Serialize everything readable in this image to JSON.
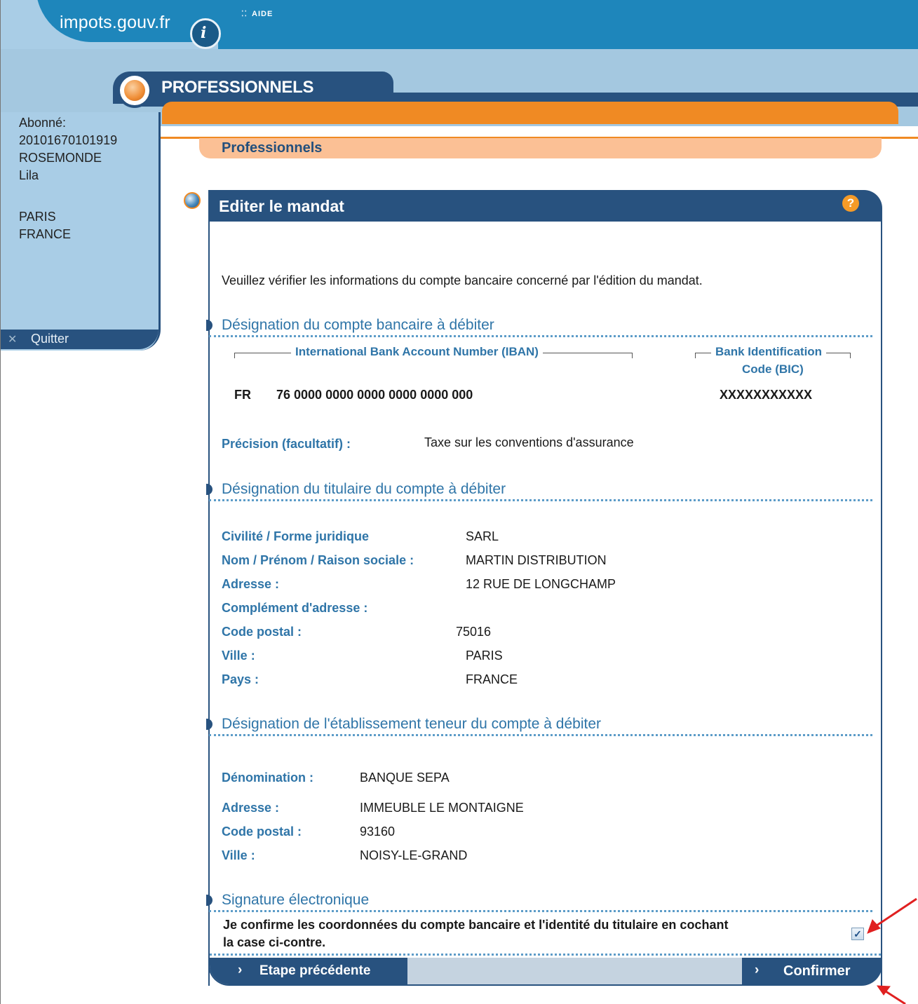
{
  "header": {
    "site_title": "impots.gouv.fr",
    "info_glyph": "i",
    "aide_label": "AIDE",
    "section_label": "PROFESSIONNELS"
  },
  "sidebar": {
    "subscriber_label": "Abonné:",
    "subscriber_id": "20101670101919",
    "last_name": "ROSEMONDE",
    "first_name": "Lila",
    "city": "PARIS",
    "country": "FRANCE",
    "quit_label": "Quitter"
  },
  "breadcrumb": "Professionnels",
  "panel": {
    "title": "Editer le mandat",
    "help_glyph": "?",
    "intro": "Veuillez vérifier les informations du compte bancaire concerné par l'édition du mandat."
  },
  "bank_account": {
    "section_title": "Désignation du compte bancaire à débiter",
    "iban_header": "International Bank Account Number  (IBAN)",
    "bic_header_line1": "Bank Identification",
    "bic_header_line2": "Code (BIC)",
    "country_code": "FR",
    "iban_value": "76  0000 0000 0000 0000 0000 000",
    "bic_value": "XXXXXXXXXXX",
    "precision_label": "Précision (facultatif) :",
    "precision_value": "Taxe sur les conventions d'assurance"
  },
  "holder": {
    "section_title": "Désignation du titulaire du compte à débiter",
    "rows": [
      {
        "label": "Civilité / Forme juridique",
        "value": "SARL"
      },
      {
        "label": "Nom / Prénom / Raison sociale :",
        "value": "MARTIN DISTRIBUTION"
      },
      {
        "label": "Adresse :",
        "value": "12 RUE DE LONGCHAMP"
      },
      {
        "label": "Complément d'adresse :",
        "value": ""
      },
      {
        "label": "Code postal :",
        "value": "75016"
      },
      {
        "label": "Ville :",
        "value": "PARIS"
      },
      {
        "label": "Pays :",
        "value": "FRANCE"
      }
    ]
  },
  "bank": {
    "section_title": "Désignation de l'établissement teneur du compte à débiter",
    "rows": [
      {
        "label": "Dénomination :",
        "value": "BANQUE SEPA"
      },
      {
        "label": "Adresse :",
        "value": "IMMEUBLE LE MONTAIGNE"
      },
      {
        "label": "Code postal :",
        "value": "93160"
      },
      {
        "label": "Ville :",
        "value": "NOISY-LE-GRAND"
      }
    ]
  },
  "signature": {
    "section_title": "Signature électronique",
    "text_line1": "Je confirme les coordonnées du compte bancaire et l'identité du titulaire en cochant",
    "text_line2": "la case ci-contre.",
    "checkbox_checked": true,
    "check_glyph": "✓"
  },
  "buttons": {
    "previous_label": "Etape précédente",
    "confirm_label": "Confirmer",
    "arrow_glyph": "›"
  },
  "colors": {
    "brand_blue": "#28527f",
    "banner_blue": "#1e86bb",
    "orange": "#f08a23",
    "label_blue": "#2f75a8",
    "annotation_red": "#e02020"
  }
}
